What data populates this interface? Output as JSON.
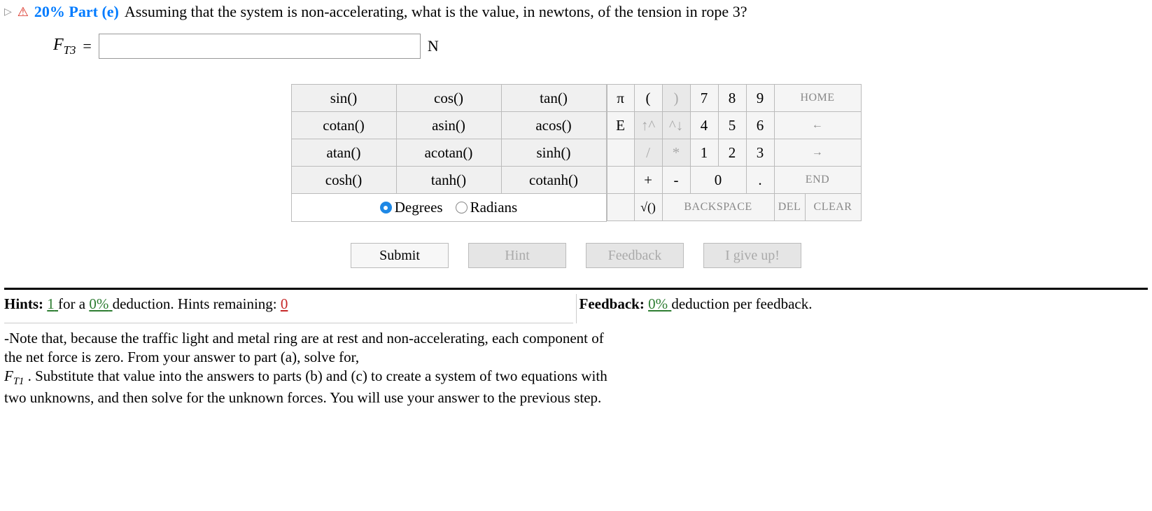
{
  "question": {
    "percent_label": "20%",
    "part_label": "Part (e)",
    "text": "Assuming that the system is non-accelerating, what is the value, in newtons, of the tension in rope 3?",
    "variable_html": "F<sub class=\"sub\">T3</sub>",
    "equals": "=",
    "unit": "N",
    "input_value": ""
  },
  "trig": {
    "rows": [
      [
        "sin()",
        "cos()",
        "tan()"
      ],
      [
        "cotan()",
        "asin()",
        "acos()"
      ],
      [
        "atan()",
        "acotan()",
        "sinh()"
      ],
      [
        "cosh()",
        "tanh()",
        "cotanh()"
      ]
    ],
    "mode_degrees": "Degrees",
    "mode_radians": "Radians",
    "mode_selected": "degrees"
  },
  "keypad": {
    "r1": {
      "c1": "π",
      "c2": "(",
      "c3": ")",
      "c4": "7",
      "c5": "8",
      "c6": "9",
      "c7": "HOME"
    },
    "r2": {
      "c1": "E",
      "c2": "↑^",
      "c3": "^↓",
      "c4": "4",
      "c5": "5",
      "c6": "6",
      "c7": "←"
    },
    "r3": {
      "c1": "",
      "c2": "/",
      "c3": "*",
      "c4": "1",
      "c5": "2",
      "c6": "3",
      "c7": "→"
    },
    "r4": {
      "c1": "",
      "c2": "+",
      "c3": "-",
      "c4": "0",
      "c5": ".",
      "c6": "END"
    },
    "r5": {
      "c1": "",
      "c2": "√()",
      "c3": "BACKSPACE",
      "c4": "DEL",
      "c5": "CLEAR"
    }
  },
  "actions": {
    "submit": "Submit",
    "hint": "Hint",
    "feedback": "Feedback",
    "giveup": "I give up!"
  },
  "hints_line": {
    "prefix": "Hints:",
    "count": "1",
    "mid1": "for a",
    "ded": "0%",
    "mid2": "deduction. Hints remaining:",
    "remaining": "0"
  },
  "feedback_line": {
    "prefix": "Feedback:",
    "ded": "0%",
    "suffix": "deduction per feedback."
  },
  "hint_text": "-Note that, because the traffic light and metal ring are at rest and non-accelerating, each component of the net force is zero. From your answer to part (a), solve for, F_T1 . Substitute that value into the answers to parts (b) and (c) to create a system of two equations with two unknowns, and then solve for the unknown forces. You will use your answer to the previous step."
}
